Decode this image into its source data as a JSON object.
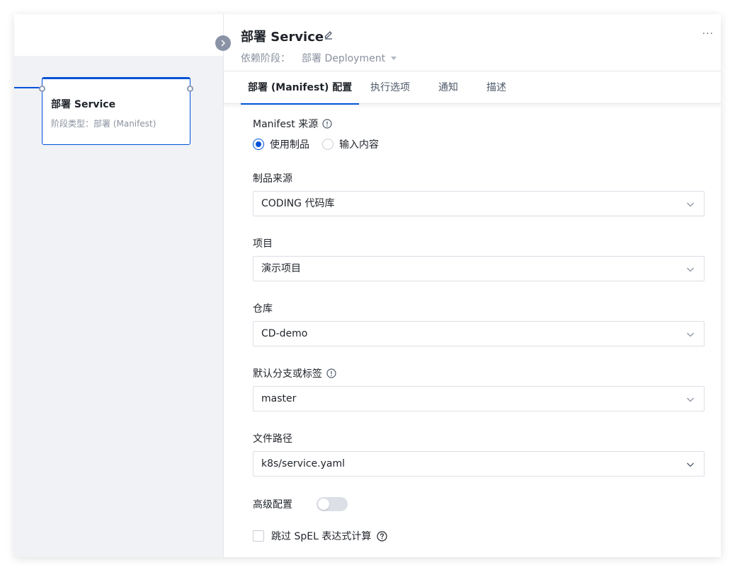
{
  "canvas": {
    "stage_card": {
      "title": "部署 Service",
      "type_label": "阶段类型：部署 (Manifest)"
    }
  },
  "panel": {
    "title": "部署 Service",
    "more_label": "···",
    "dependency": {
      "label": "依赖阶段：",
      "value": "部署 Deployment"
    },
    "tabs": [
      {
        "label": "部署 (Manifest) 配置",
        "active": true
      },
      {
        "label": "执行选项",
        "active": false
      },
      {
        "label": "通知",
        "active": false
      },
      {
        "label": "描述",
        "active": false
      }
    ],
    "form": {
      "manifest_source": {
        "label": "Manifest 来源",
        "options": [
          {
            "label": "使用制品",
            "checked": true
          },
          {
            "label": "输入内容",
            "checked": false
          }
        ]
      },
      "artifact_source": {
        "label": "制品来源",
        "value": "CODING 代码库"
      },
      "project": {
        "label": "项目",
        "value": "演示项目"
      },
      "repository": {
        "label": "仓库",
        "value": "CD-demo"
      },
      "default_branch": {
        "label": "默认分支或标签",
        "value": "master"
      },
      "file_path": {
        "label": "文件路径",
        "value": "k8s/service.yaml"
      },
      "advanced": {
        "label": "高级配置",
        "enabled": false
      },
      "skip_spel": {
        "label": "跳过 SpEL 表达式计算",
        "checked": false
      }
    }
  },
  "colors": {
    "accent": "#0052d9",
    "canvas_bg": "#f0f2f6",
    "muted_text": "#8a919f"
  }
}
